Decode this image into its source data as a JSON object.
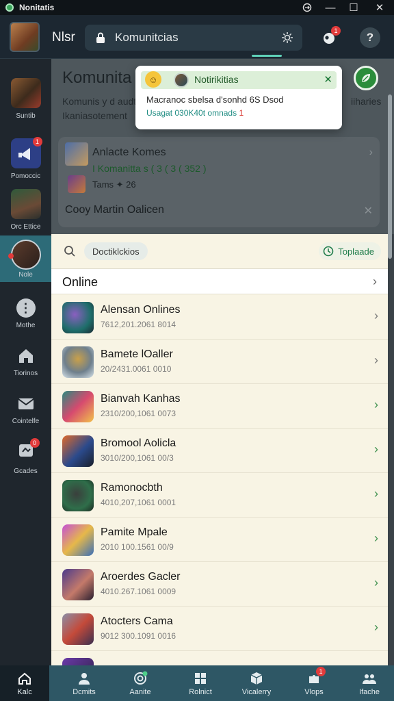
{
  "window": {
    "title": "Nonitatis",
    "minimize_glyph": "—",
    "maximize_glyph": "☐",
    "close_glyph": "✕"
  },
  "header": {
    "username": "Nlsr",
    "search_text": "Komunitcias",
    "notification_badge": "1",
    "help_glyph": "?"
  },
  "sidebar": {
    "items": [
      {
        "label": "Suntib",
        "icon": "avatar-warrior"
      },
      {
        "label": "Pomoccic",
        "icon": "megaphone-icon",
        "badge": "1"
      },
      {
        "label": "Orc Ettice",
        "icon": "avatar-man"
      },
      {
        "label": "Nole",
        "icon": "avatar-profile",
        "active": true
      },
      {
        "label": "Mothe",
        "icon": "info-icon"
      },
      {
        "label": "Tiorinos",
        "icon": "home-icon"
      },
      {
        "label": "Cointelfe",
        "icon": "mail-icon"
      },
      {
        "label": "Gcades",
        "icon": "badge-icon",
        "badge": "0"
      }
    ]
  },
  "community": {
    "title": "Komunita",
    "description_left": "Komunis y d audt",
    "description_right": "iiharies",
    "description_line2": "Ikaniasotement",
    "card": {
      "title": "Anlacte Komes",
      "stats": "I Komanitta s ( 3 ( 3 ( 352 )",
      "points": "Tams ✦ 26",
      "featured": "Cooy Martin Oalicen"
    }
  },
  "notification": {
    "title": "Notirikitias",
    "message": "Macranoc sbelsa d'sonhd 6S Dsod",
    "meta": "Usagat 030K40t omnads",
    "meta_badge": "1",
    "close_glyph": "✕"
  },
  "list": {
    "filter_chip": "Doctiklckios",
    "upload_label": "Toplaade",
    "section_title": "Online",
    "games": [
      {
        "name": "Alensan Onlines",
        "sub": "7612,201.2061 8014",
        "chev_color": "#777777"
      },
      {
        "name": "Bamete lOaller",
        "sub": "20/2431.0061 0010",
        "chev_color": "#777777"
      },
      {
        "name": "Bianvah Kanhas",
        "sub": "2310/200,1061 0073",
        "chev_color": "#3c8f4c"
      },
      {
        "name": "Bromool Aolicla",
        "sub": "3010/200,1061 00/3",
        "chev_color": "#3c8f4c"
      },
      {
        "name": "Ramonocbth",
        "sub": "4010,207,1061 0001",
        "chev_color": "#3c8f4c"
      },
      {
        "name": "Pamite Mpale",
        "sub": "2010 100.1561 00/9",
        "chev_color": "#3c8f4c"
      },
      {
        "name": "Aroerdes Gacler",
        "sub": "4010.267.1061 0009",
        "chev_color": "#3c8f4c"
      },
      {
        "name": "Atocters Cama",
        "sub": "9012 300.1091 0016",
        "chev_color": "#3c8f4c"
      }
    ]
  },
  "bottom_nav": {
    "items": [
      {
        "label": "Kalc",
        "icon": "home-icon"
      },
      {
        "label": "Dcmits",
        "icon": "person-icon"
      },
      {
        "label": "Aanite",
        "icon": "target-icon"
      },
      {
        "label": "Rolnict",
        "icon": "grid-icon"
      },
      {
        "label": "Vicalerry",
        "icon": "cube-icon"
      },
      {
        "label": "Vlops",
        "icon": "puzzle-icon",
        "badge": "1"
      },
      {
        "label": "Ifache",
        "icon": "group-icon"
      }
    ]
  },
  "colors": {
    "accent_teal": "#5fd1b8",
    "accent_green": "#2b8d3b",
    "badge_red": "#e23b3b",
    "sidebar_active": "#2d6b78",
    "bottom_nav": "#2e5765"
  }
}
